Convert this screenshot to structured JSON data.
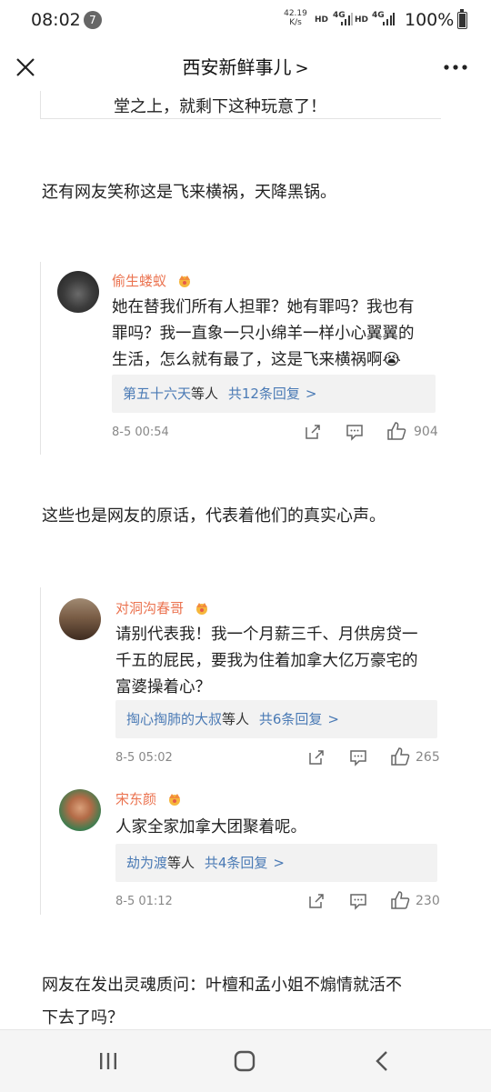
{
  "status_bar": {
    "time": "08:02",
    "notification_count": "7",
    "net_speed_value": "42.19",
    "net_speed_unit": "K/s",
    "net_label_1": "HD",
    "net_label_2": "4G",
    "net_label_3": "HD",
    "net_label_4": "4G",
    "battery": "100%"
  },
  "nav": {
    "title": "西安新鲜事儿",
    "title_chevron": ">",
    "close_icon": "close-icon",
    "more_icon": "more-dots-icon"
  },
  "article": {
    "quote_fragment": "堂之上，就剩下这种玩意了！",
    "para1": "还有网友笑称这是飞来横祸，天降黑锅。",
    "para2": "这些也是网友的原话，代表着他们的真实心声。",
    "para3_line1": "网友在发出灵魂质问：叶檀和孟小姐不煽情就活不",
    "para3_line2": "下去了吗？"
  },
  "comments": [
    {
      "user": "偷生蝼蚁",
      "badge": "crown-icon",
      "lines": [
        "她在替我们所有人担罪？她有罪吗？我也有",
        "罪吗？我一直象一只小绵羊一样小心翼翼的",
        "生活，怎么就有最了，这是飞来横祸啊😭"
      ],
      "reply_user": "第五十六天",
      "reply_suffix": "等人",
      "reply_count": "共12条回复",
      "reply_chevron": ">",
      "time": "8-5 00:54",
      "likes": "904"
    },
    {
      "user": "对洞沟春哥",
      "badge": "crown-icon",
      "lines": [
        "请别代表我！我一个月薪三千、月供房贷一",
        "千五的屁民，要我为住着加拿大亿万豪宅的",
        "富婆操着心？"
      ],
      "reply_user": "掏心掏肺的大叔",
      "reply_suffix": "等人",
      "reply_count": "共6条回复",
      "reply_chevron": ">",
      "time": "8-5 05:02",
      "likes": "265"
    },
    {
      "user": "宋东颜",
      "badge": "crown-icon",
      "lines": [
        "人家全家加拿大团聚着呢。"
      ],
      "reply_user": "劫为渡",
      "reply_suffix": "等人",
      "reply_count": "共4条回复",
      "reply_chevron": ">",
      "time": "8-5 01:12",
      "likes": "230"
    }
  ],
  "colors": {
    "username": "#eb7350",
    "link": "#4a7ab5",
    "reply_bg": "#f2f2f2"
  }
}
